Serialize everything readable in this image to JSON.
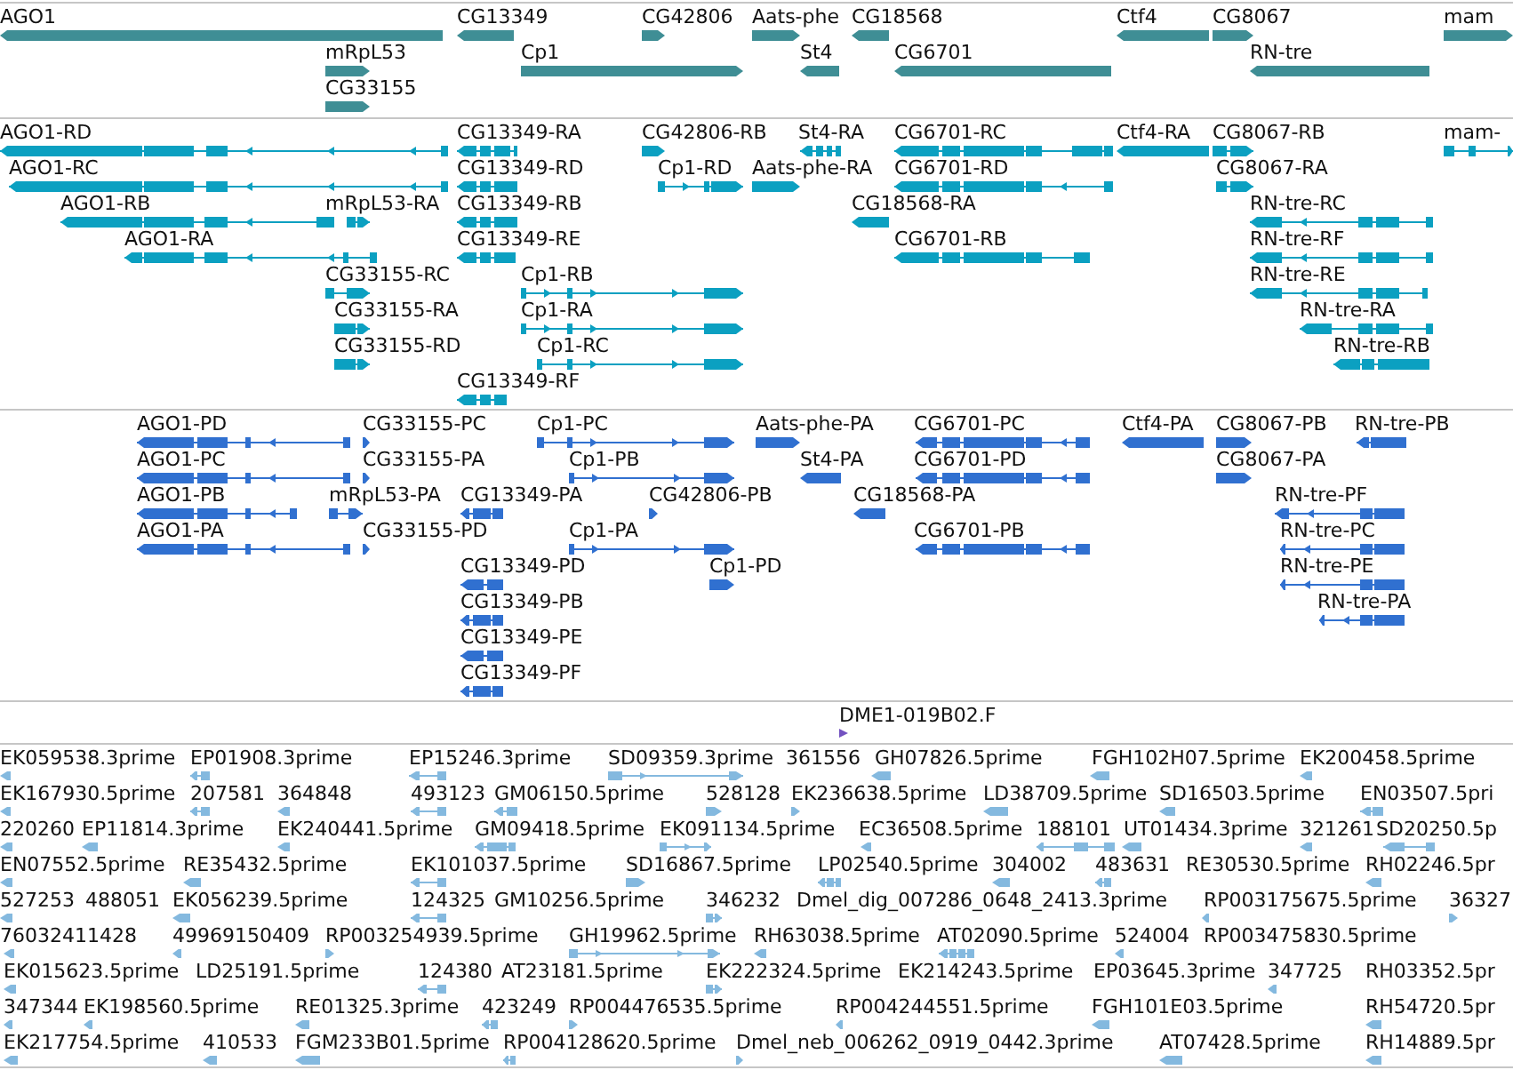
{
  "tracks": [
    {
      "kind": "gene",
      "color": "#3f8e95",
      "features": [
        {
          "label": "AGO1",
          "reverse": true
        },
        {
          "label": "CG13349",
          "reverse": true
        },
        {
          "label": "CG42806",
          "reverse": false
        },
        {
          "label": "Aats-phe",
          "reverse": false
        },
        {
          "label": "CG18568",
          "reverse": true
        },
        {
          "label": "Ctf4",
          "reverse": true
        },
        {
          "label": "CG8067",
          "reverse": false
        },
        {
          "label": "mam",
          "reverse": false
        },
        {
          "label": "mRpL53",
          "reverse": false
        },
        {
          "label": "Cp1",
          "reverse": false
        },
        {
          "label": "St4",
          "reverse": true
        },
        {
          "label": "CG6701",
          "reverse": true
        },
        {
          "label": "RN-tre",
          "reverse": true
        },
        {
          "label": "CG33155",
          "reverse": false
        }
      ]
    },
    {
      "kind": "transcript",
      "color": "#0ba0c1",
      "features": [
        {
          "label": "AGO1-RD",
          "reverse": true
        },
        {
          "label": "CG13349-RA",
          "reverse": true
        },
        {
          "label": "CG42806-RB",
          "reverse": false
        },
        {
          "label": "St4-RA",
          "reverse": true
        },
        {
          "label": "CG6701-RC",
          "reverse": true
        },
        {
          "label": "Ctf4-RA",
          "reverse": true
        },
        {
          "label": "CG8067-RB",
          "reverse": false
        },
        {
          "label": "mam-",
          "reverse": false
        },
        {
          "label": "AGO1-RC",
          "reverse": true
        },
        {
          "label": "CG13349-RD",
          "reverse": true
        },
        {
          "label": "Cp1-RD",
          "reverse": false
        },
        {
          "label": "Aats-phe-RA",
          "reverse": false
        },
        {
          "label": "CG6701-RD",
          "reverse": true
        },
        {
          "label": "CG8067-RA",
          "reverse": false
        },
        {
          "label": "AGO1-RB",
          "reverse": true
        },
        {
          "label": "mRpL53-RA",
          "reverse": false
        },
        {
          "label": "CG13349-RB",
          "reverse": true
        },
        {
          "label": "CG18568-RA",
          "reverse": true
        },
        {
          "label": "RN-tre-RC",
          "reverse": true
        },
        {
          "label": "AGO1-RA",
          "reverse": true
        },
        {
          "label": "CG13349-RE",
          "reverse": true
        },
        {
          "label": "CG6701-RB",
          "reverse": true
        },
        {
          "label": "RN-tre-RF",
          "reverse": true
        },
        {
          "label": "CG33155-RC",
          "reverse": false
        },
        {
          "label": "Cp1-RB",
          "reverse": false
        },
        {
          "label": "RN-tre-RE",
          "reverse": true
        },
        {
          "label": "CG33155-RA",
          "reverse": false
        },
        {
          "label": "Cp1-RA",
          "reverse": false
        },
        {
          "label": "RN-tre-RA",
          "reverse": true
        },
        {
          "label": "CG33155-RD",
          "reverse": false
        },
        {
          "label": "Cp1-RC",
          "reverse": false
        },
        {
          "label": "RN-tre-RB",
          "reverse": true
        },
        {
          "label": "CG13349-RF",
          "reverse": true
        }
      ]
    },
    {
      "kind": "protein",
      "color": "#3070d0",
      "features": [
        {
          "label": "AGO1-PD",
          "reverse": true
        },
        {
          "label": "CG33155-PC",
          "reverse": false
        },
        {
          "label": "Cp1-PC",
          "reverse": false
        },
        {
          "label": "Aats-phe-PA",
          "reverse": false
        },
        {
          "label": "CG6701-PC",
          "reverse": true
        },
        {
          "label": "Ctf4-PA",
          "reverse": true
        },
        {
          "label": "CG8067-PB",
          "reverse": false
        },
        {
          "label": "RN-tre-PB",
          "reverse": true
        },
        {
          "label": "AGO1-PC",
          "reverse": true
        },
        {
          "label": "CG33155-PA",
          "reverse": false
        },
        {
          "label": "Cp1-PB",
          "reverse": false
        },
        {
          "label": "St4-PA",
          "reverse": true
        },
        {
          "label": "CG6701-PD",
          "reverse": true
        },
        {
          "label": "CG8067-PA",
          "reverse": false
        },
        {
          "label": "AGO1-PB",
          "reverse": true
        },
        {
          "label": "mRpL53-PA",
          "reverse": false
        },
        {
          "label": "CG13349-PA",
          "reverse": true
        },
        {
          "label": "CG42806-PB",
          "reverse": false
        },
        {
          "label": "CG18568-PA",
          "reverse": true
        },
        {
          "label": "RN-tre-PF",
          "reverse": true
        },
        {
          "label": "AGO1-PA",
          "reverse": true
        },
        {
          "label": "CG33155-PD",
          "reverse": false
        },
        {
          "label": "Cp1-PA",
          "reverse": false
        },
        {
          "label": "CG6701-PB",
          "reverse": true
        },
        {
          "label": "RN-tre-PC",
          "reverse": true
        },
        {
          "label": "CG13349-PD",
          "reverse": true
        },
        {
          "label": "Cp1-PD",
          "reverse": false
        },
        {
          "label": "RN-tre-PE",
          "reverse": true
        },
        {
          "label": "CG13349-PB",
          "reverse": true
        },
        {
          "label": "RN-tre-PA",
          "reverse": true
        },
        {
          "label": "CG13349-PE",
          "reverse": true
        },
        {
          "label": "CG13349-PF",
          "reverse": true
        }
      ]
    },
    {
      "kind": "clone",
      "color": "#7352c0",
      "features": [
        {
          "label": "DME1-019B02.F",
          "reverse": false
        }
      ]
    },
    {
      "kind": "est",
      "color": "#84b9df",
      "features": [
        {
          "label": "EK059538.3prime",
          "reverse": true
        },
        {
          "label": "EP01908.3prime",
          "reverse": true
        },
        {
          "label": "EP15246.3prime",
          "reverse": true
        },
        {
          "label": "SD09359.3prime",
          "reverse": false
        },
        {
          "label": "361556"
        },
        {
          "label": "GH07826.5prime",
          "reverse": true
        },
        {
          "label": "FGH102H07.5prime",
          "reverse": true
        },
        {
          "label": "EK200458.5prime",
          "reverse": true
        },
        {
          "label": "EK167930.5prime",
          "reverse": true
        },
        {
          "label": "207581",
          "reverse": true
        },
        {
          "label": "364848",
          "reverse": true
        },
        {
          "label": "493123",
          "reverse": true
        },
        {
          "label": "GM06150.5prime",
          "reverse": true
        },
        {
          "label": "528128",
          "reverse": false
        },
        {
          "label": "EK236638.5prime",
          "reverse": false
        },
        {
          "label": "LD38709.5prime",
          "reverse": true
        },
        {
          "label": "SD16503.5prime",
          "reverse": true
        },
        {
          "label": "EN03507.5pri",
          "reverse": true
        },
        {
          "label": "220260",
          "reverse": true
        },
        {
          "label": "EP11814.3prime",
          "reverse": true
        },
        {
          "label": "EK240441.5prime",
          "reverse": true
        },
        {
          "label": "GM09418.5prime",
          "reverse": true
        },
        {
          "label": "EK091134.5prime",
          "reverse": false
        },
        {
          "label": "EC36508.5prime",
          "reverse": true
        },
        {
          "label": "188101",
          "reverse": true
        },
        {
          "label": "UT01434.3prime",
          "reverse": true
        },
        {
          "label": "321261",
          "reverse": true
        },
        {
          "label": "SD20250.5p",
          "reverse": true
        },
        {
          "label": "EN07552.5prime",
          "reverse": true
        },
        {
          "label": "RE35432.5prime",
          "reverse": true
        },
        {
          "label": "EK101037.5prime",
          "reverse": true
        },
        {
          "label": "SD16867.5prime",
          "reverse": false
        },
        {
          "label": "LP02540.5prime",
          "reverse": true
        },
        {
          "label": "304002",
          "reverse": true
        },
        {
          "label": "483631",
          "reverse": true
        },
        {
          "label": "RE30530.5prime"
        },
        {
          "label": "RH02246.5pr",
          "reverse": true
        },
        {
          "label": "527253",
          "reverse": true
        },
        {
          "label": "488051"
        },
        {
          "label": "EK056239.5prime",
          "reverse": true
        },
        {
          "label": "124325",
          "reverse": true
        },
        {
          "label": "GM10256.5prime"
        },
        {
          "label": "346232",
          "reverse": false
        },
        {
          "label": "Dmel_dig_007286_0648_2413.3prime"
        },
        {
          "label": "RP003175675.5prime",
          "reverse": true
        },
        {
          "label": "36327",
          "reverse": false
        },
        {
          "label": "76032411428",
          "reverse": true
        },
        {
          "label": "49969150409",
          "reverse": true
        },
        {
          "label": "RP003254939.5prime",
          "reverse": false
        },
        {
          "label": "GH19962.5prime",
          "reverse": false
        },
        {
          "label": "RH63038.5prime",
          "reverse": true
        },
        {
          "label": "AT02090.5prime",
          "reverse": true
        },
        {
          "label": "524004",
          "reverse": true
        },
        {
          "label": "RP003475830.5prime"
        },
        {
          "label": "EK015623.5prime",
          "reverse": true
        },
        {
          "label": "LD25191.5prime"
        },
        {
          "label": "124380",
          "reverse": true
        },
        {
          "label": "AT23181.5prime"
        },
        {
          "label": "EK222324.5prime",
          "reverse": false
        },
        {
          "label": "EK214243.5prime"
        },
        {
          "label": "EP03645.3prime"
        },
        {
          "label": "347725",
          "reverse": true
        },
        {
          "label": "RH03352.5pr"
        },
        {
          "label": "347344",
          "reverse": true
        },
        {
          "label": "EK198560.5prime",
          "reverse": true
        },
        {
          "label": "RE01325.3prime",
          "reverse": true
        },
        {
          "label": "423249",
          "reverse": true
        },
        {
          "label": "RP004476535.5prime",
          "reverse": false
        },
        {
          "label": "RP004244551.5prime",
          "reverse": true
        },
        {
          "label": "FGH101E03.5prime",
          "reverse": true
        },
        {
          "label": "RH54720.5pr",
          "reverse": true
        },
        {
          "label": "EK217754.5prime",
          "reverse": true
        },
        {
          "label": "410533",
          "reverse": true
        },
        {
          "label": "FGM233B01.5prime",
          "reverse": true
        },
        {
          "label": "RP004128620.5prime",
          "reverse": true
        },
        {
          "label": "Dmel_neb_006262_0919_0442.3prime",
          "reverse": false
        },
        {
          "label": "AT07428.5prime",
          "reverse": true
        },
        {
          "label": "RH14889.5pr",
          "reverse": true
        }
      ]
    }
  ]
}
